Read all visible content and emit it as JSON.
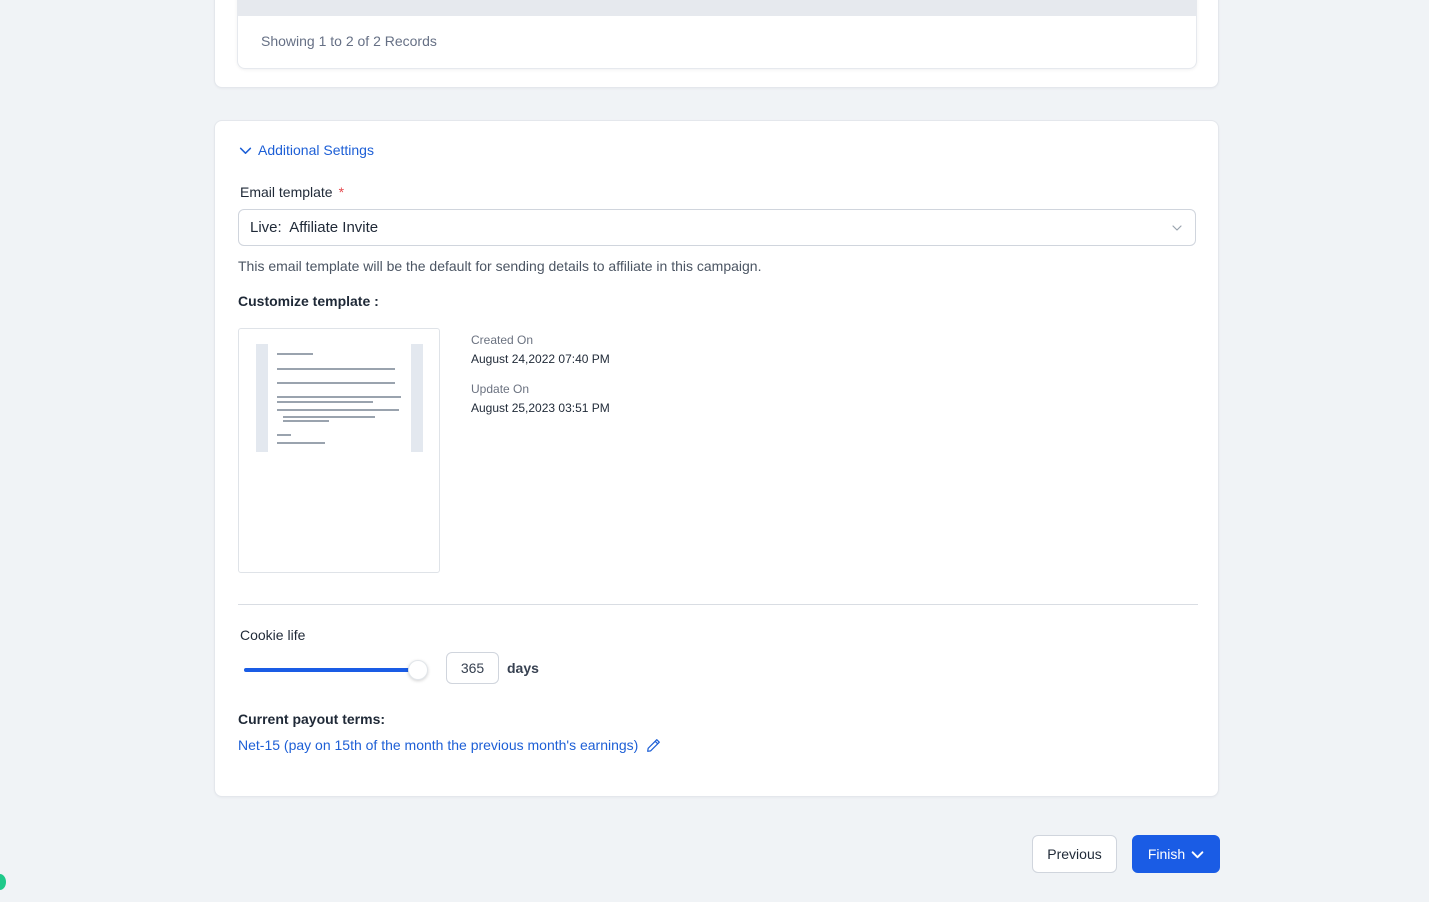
{
  "records": {
    "summary": "Showing 1 to 2 of 2 Records"
  },
  "additional_settings": {
    "toggle_label": "Additional Settings",
    "email_template": {
      "label": "Email template",
      "required_mark": "*",
      "selected": "Live:  Affiliate Invite",
      "help": "This email template will be the default for sending details to affiliate in this campaign."
    },
    "customize": {
      "title": "Customize template :",
      "created_label": "Created On",
      "created_value": "August 24,2022 07:40 PM",
      "updated_label": "Update On",
      "updated_value": "August 25,2023 03:51 PM"
    },
    "cookie": {
      "label": "Cookie life",
      "value": "365",
      "unit": "days",
      "slider_fraction": 1.0
    },
    "payout": {
      "label": "Current payout terms:",
      "value": "Net-15 (pay on 15th of the month the previous month's earnings)"
    }
  },
  "footer": {
    "previous_label": "Previous",
    "finish_label": "Finish"
  },
  "colors": {
    "accent": "#1a5ce5",
    "link": "#1d5fd6",
    "background": "#f0f3f6",
    "required": "#e5484d",
    "status_dot": "#1fc98a"
  },
  "icons": {
    "toggle": "chevron-down-icon",
    "select": "chevron-down-icon",
    "payout_edit": "pencil-icon",
    "finish": "chevron-down-icon"
  }
}
